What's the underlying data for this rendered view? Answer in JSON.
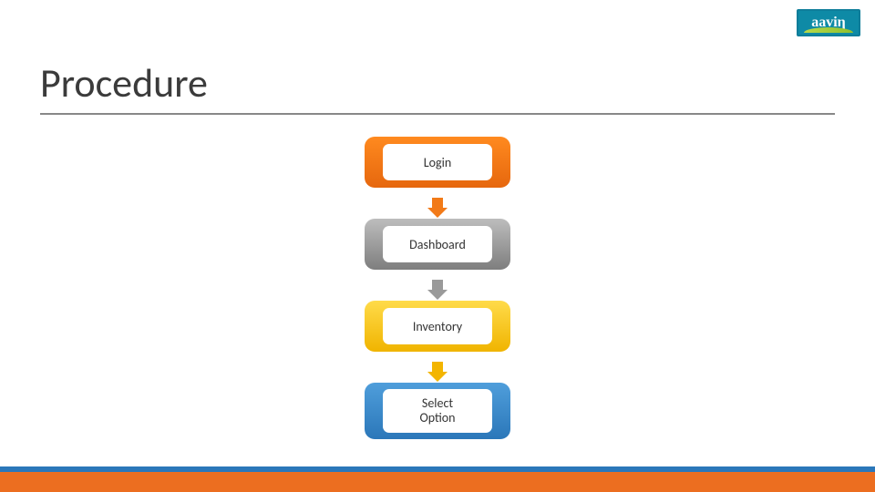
{
  "logo": {
    "text": "aaviη"
  },
  "title": "Procedure",
  "steps": [
    {
      "label": "Login",
      "color": "orange"
    },
    {
      "label": "Dashboard",
      "color": "gray"
    },
    {
      "label": "Inventory",
      "color": "gold"
    },
    {
      "label": "Select\nOption",
      "color": "blue"
    }
  ],
  "arrows": [
    {
      "color": "orange"
    },
    {
      "color": "gray"
    },
    {
      "color": "gold"
    }
  ]
}
